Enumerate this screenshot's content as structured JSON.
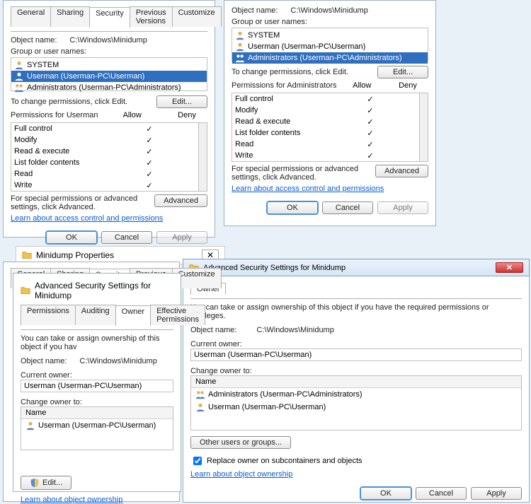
{
  "tabs": [
    "General",
    "Sharing",
    "Security",
    "Previous Versions",
    "Customize"
  ],
  "objectNameLabel": "Object name:",
  "objectName": "C:\\Windows\\Minidump",
  "groupLabel": "Group or user names:",
  "users": {
    "system": "SYSTEM",
    "userman": "Userman (Userman-PC\\Userman)",
    "admins": "Administrators (Userman-PC\\Administrators)"
  },
  "changePerm": "To change permissions, click Edit.",
  "editBtn": "Edit...",
  "permLabelUser": "Permissions for Userman",
  "permLabelAdmin": "Permissions for Administrators",
  "permCols": {
    "allow": "Allow",
    "deny": "Deny"
  },
  "perms": [
    "Full control",
    "Modify",
    "Read & execute",
    "List folder contents",
    "Read",
    "Write"
  ],
  "specialPerm": "For special permissions or advanced settings, click Advanced.",
  "advancedBtn": "Advanced",
  "learnAcl": "Learn about access control and permissions",
  "buttons": {
    "ok": "OK",
    "cancel": "Cancel",
    "apply": "Apply"
  },
  "propTitle": "Minidump Properties",
  "advTitle": "Advanced Security Settings for Minidump",
  "advTabs": [
    "Permissions",
    "Auditing",
    "Owner",
    "Effective Permissions"
  ],
  "ownerTab": "Owner",
  "ownerInstr": "You can take or assign ownership of this object if you have the required permissions or privileges.",
  "ownerInstrShort": "You can take or assign ownership of this object if you hav",
  "currentOwnerLabel": "Current owner:",
  "currentOwner": "Userman (Userman-PC\\Userman)",
  "changeOwnerLabel": "Change owner to:",
  "nameCol": "Name",
  "ownersLeft": [
    "Userman (Userman-PC\\Userman)"
  ],
  "ownersRight": [
    "Administrators (Userman-PC\\Administrators)",
    "Userman (Userman-PC\\Userman)"
  ],
  "otherUsersBtn": "Other users or groups...",
  "replaceOwnerChk": "Replace owner on subcontainers and objects",
  "learnOwner": "Learn about object ownership"
}
